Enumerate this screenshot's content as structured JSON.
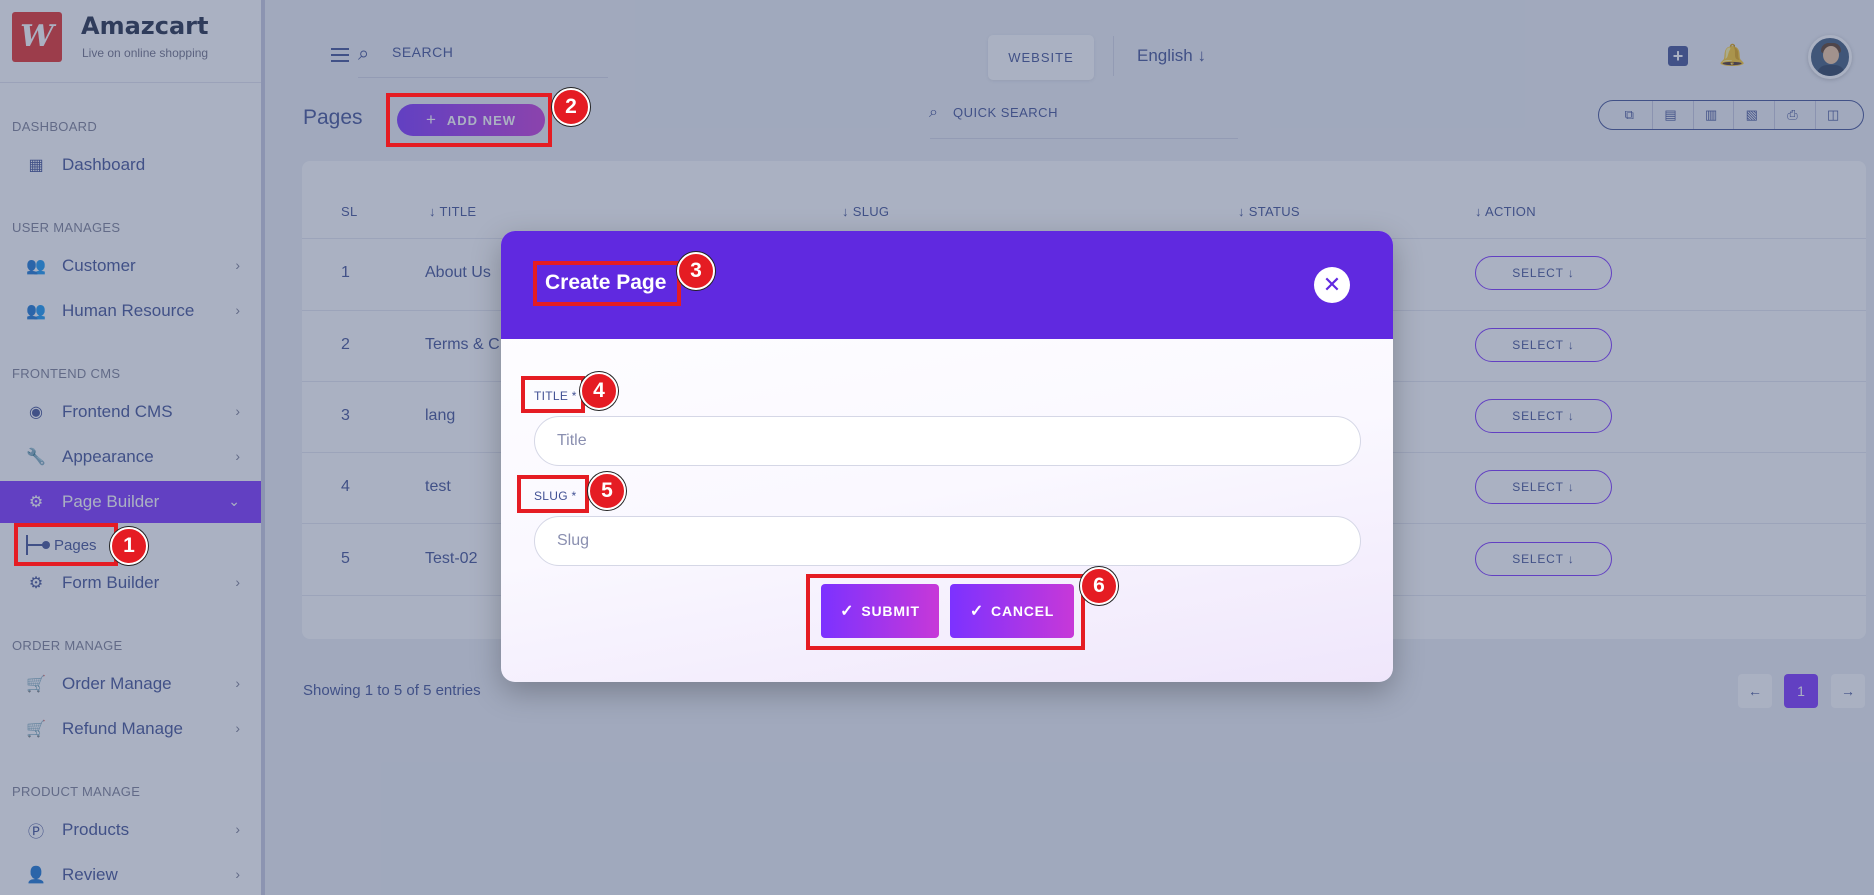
{
  "brand": {
    "logo_text": "W",
    "name": "Amazcart",
    "tagline": "Live on online shopping"
  },
  "sidebar": {
    "sections": [
      {
        "label": "DASHBOARD"
      },
      {
        "label": "USER MANAGES"
      },
      {
        "label": "FRONTEND CMS"
      },
      {
        "label": "ORDER MANAGE"
      },
      {
        "label": "PRODUCT MANAGE"
      }
    ],
    "items": [
      {
        "label": "Dashboard",
        "icon": "grid-icon"
      },
      {
        "label": "Customer",
        "icon": "users-icon"
      },
      {
        "label": "Human Resource",
        "icon": "users-icon"
      },
      {
        "label": "Frontend CMS",
        "icon": "eye-icon"
      },
      {
        "label": "Appearance",
        "icon": "wrench-icon"
      },
      {
        "label": "Page Builder",
        "icon": "gears-icon"
      },
      {
        "label": "Form Builder",
        "icon": "gears-icon"
      },
      {
        "label": "Order Manage",
        "icon": "cart-icon"
      },
      {
        "label": "Refund Manage",
        "icon": "cart-icon"
      },
      {
        "label": "Products",
        "icon": "product-icon"
      },
      {
        "label": "Review",
        "icon": "user-icon"
      }
    ],
    "sub_item": {
      "label": "Pages"
    }
  },
  "topbar": {
    "search_placeholder": "SEARCH",
    "website_label": "WEBSITE",
    "language": "English"
  },
  "page": {
    "title": "Pages",
    "add_new_label": "ADD NEW",
    "quick_search_placeholder": "QUICK SEARCH",
    "columns": [
      "SL",
      "TITLE",
      "SLUG",
      "STATUS",
      "ACTION"
    ],
    "rows": [
      {
        "sl": "1",
        "title": "About Us",
        "action": "SELECT"
      },
      {
        "sl": "2",
        "title": "Terms & C",
        "action": "SELECT"
      },
      {
        "sl": "3",
        "title": "lang",
        "action": "SELECT"
      },
      {
        "sl": "4",
        "title": "test",
        "action": "SELECT"
      },
      {
        "sl": "5",
        "title": "Test-02",
        "action": "SELECT"
      }
    ],
    "showing": "Showing 1 to 5 of 5 entries",
    "pagination": {
      "prev": "←",
      "current": "1",
      "next": "→"
    }
  },
  "modal": {
    "title": "Create Page",
    "title_label": "TITLE *",
    "title_placeholder": "Title",
    "slug_label": "SLUG *",
    "slug_placeholder": "Slug",
    "submit_label": "SUBMIT",
    "cancel_label": "CANCEL"
  },
  "annotations": [
    "1",
    "2",
    "3",
    "4",
    "5",
    "6"
  ],
  "colors": {
    "accent": "#7c32ff",
    "modal_header": "#6029e0",
    "marker": "#e51c23",
    "text": "#415094"
  }
}
